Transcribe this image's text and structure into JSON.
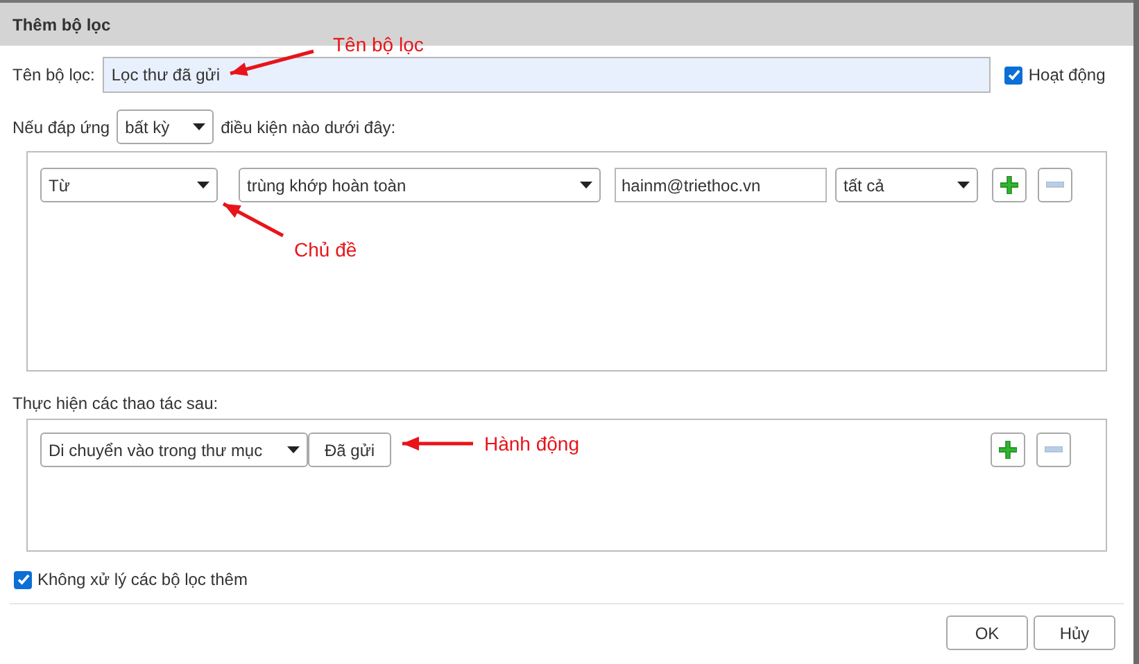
{
  "dialog": {
    "title": "Thêm bộ lọc"
  },
  "name_row": {
    "label": "Tên bộ lọc:",
    "value": "Lọc thư đã gửi",
    "active": {
      "label": "Hoạt động",
      "checked": true
    }
  },
  "match_row": {
    "prefix": "Nếu đáp ứng",
    "select": "bất kỳ",
    "suffix": "điều kiện nào dưới đây:"
  },
  "conditions": [
    {
      "field": "Từ",
      "operator": "trùng khớp hoàn toàn",
      "value": "hainm@triethoc.vn",
      "scope": "tất cả"
    }
  ],
  "actions_label": "Thực hiện các thao tác sau:",
  "actions": [
    {
      "action": "Di chuyển vào trong thư mục",
      "target": "Đã gửi"
    }
  ],
  "stop_processing": {
    "label": "Không xử lý các bộ lọc thêm",
    "checked": true
  },
  "buttons": [
    "OK",
    "Hủy"
  ],
  "annotations": [
    {
      "text": "Tên bộ lọc"
    },
    {
      "text": "Chủ đề"
    },
    {
      "text": "Hành động"
    }
  ]
}
